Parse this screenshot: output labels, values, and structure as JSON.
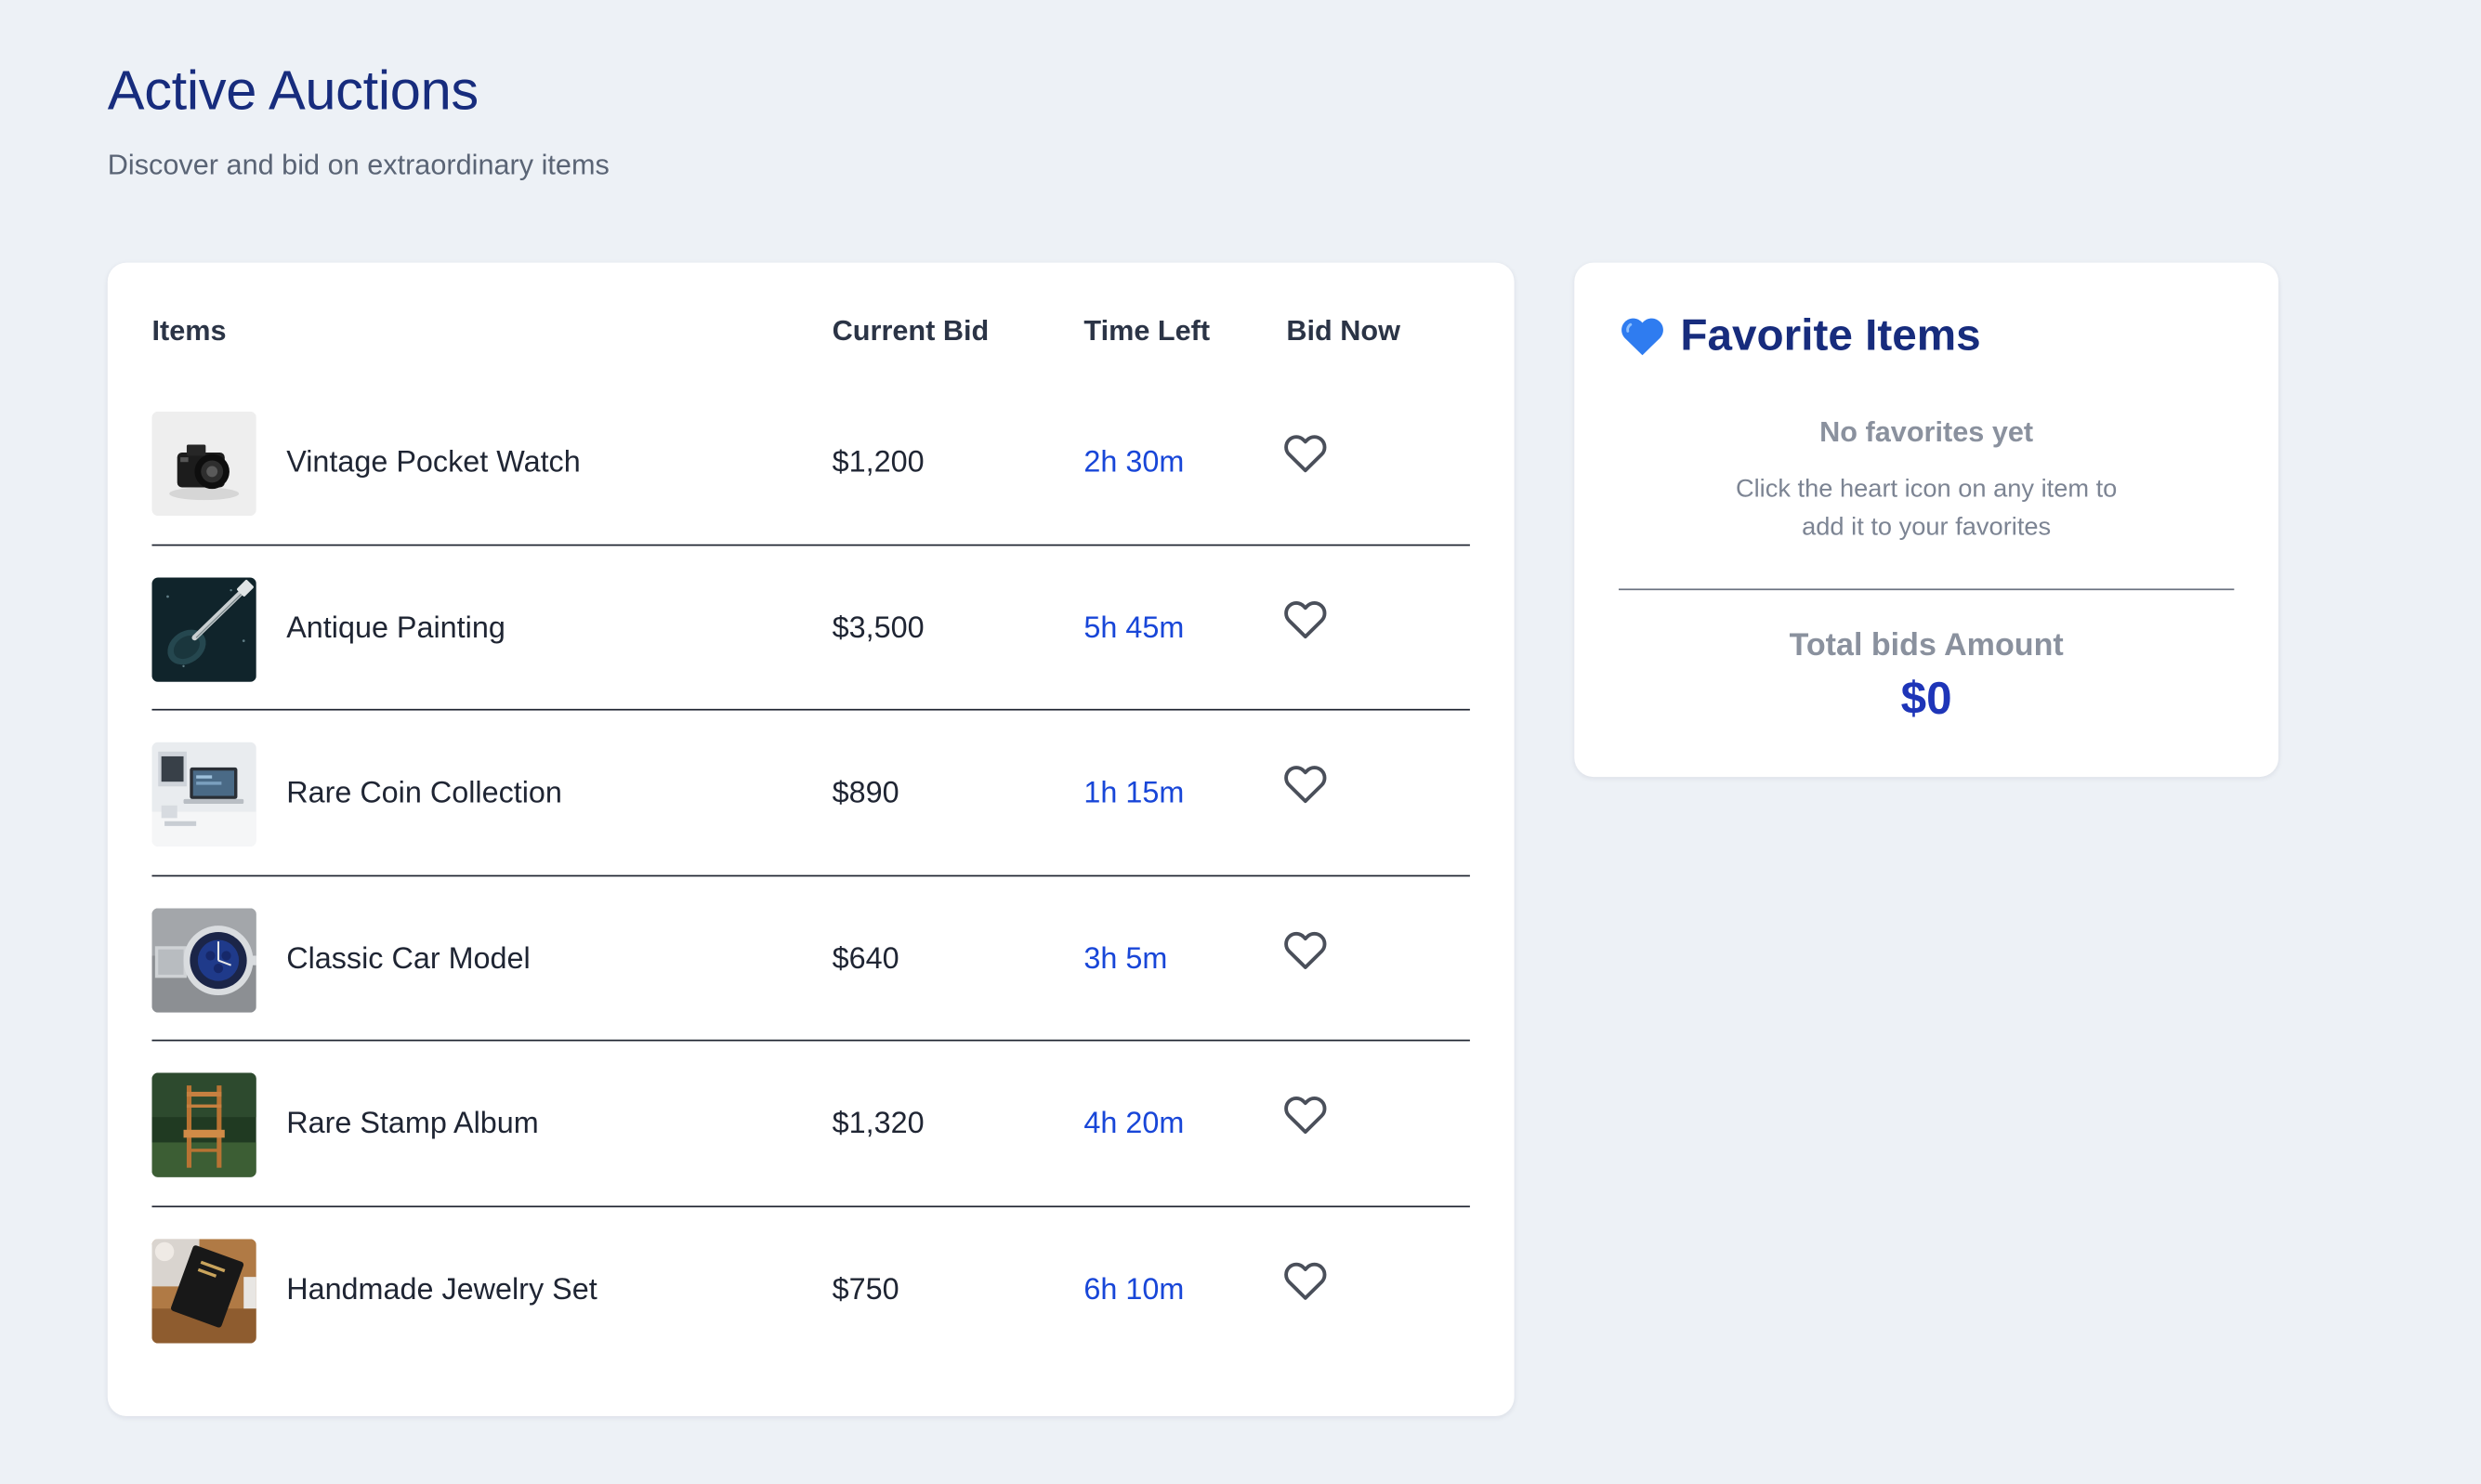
{
  "header": {
    "title": "Active Auctions",
    "subtitle": "Discover and bid on extraordinary items"
  },
  "table": {
    "columns": [
      "Items",
      "Current Bid",
      "Time Left",
      "Bid Now"
    ],
    "rows": [
      {
        "name": "Vintage Pocket Watch",
        "bid": "$1,200",
        "time": "2h 30m",
        "thumbnail": "camera-photo",
        "favorite": false
      },
      {
        "name": "Antique Painting",
        "bid": "$3,500",
        "time": "5h 45m",
        "thumbnail": "guitar-photo",
        "favorite": false
      },
      {
        "name": "Rare Coin Collection",
        "bid": "$890",
        "time": "1h 15m",
        "thumbnail": "laptop-desk-photo",
        "favorite": false
      },
      {
        "name": "Classic Car Model",
        "bid": "$640",
        "time": "3h 5m",
        "thumbnail": "wristwatch-photo",
        "favorite": false
      },
      {
        "name": "Rare Stamp Album",
        "bid": "$1,320",
        "time": "4h 20m",
        "thumbnail": "wooden-chair-photo",
        "favorite": false
      },
      {
        "name": "Handmade Jewelry Set",
        "bid": "$750",
        "time": "6h 10m",
        "thumbnail": "book-photo",
        "favorite": false
      }
    ]
  },
  "favorites": {
    "title": "Favorite Items",
    "icon": "blue-heart-icon",
    "empty_title": "No favorites yet",
    "empty_hint": "Click the heart icon on any item to add it to your favorites",
    "total_label": "Total bids Amount",
    "total_value": "$0"
  },
  "colors": {
    "page_background": "#edf1f6",
    "title": "#172c7d",
    "time_left": "#1846d8",
    "total_value": "#1e35b8",
    "card": "#ffffff"
  }
}
